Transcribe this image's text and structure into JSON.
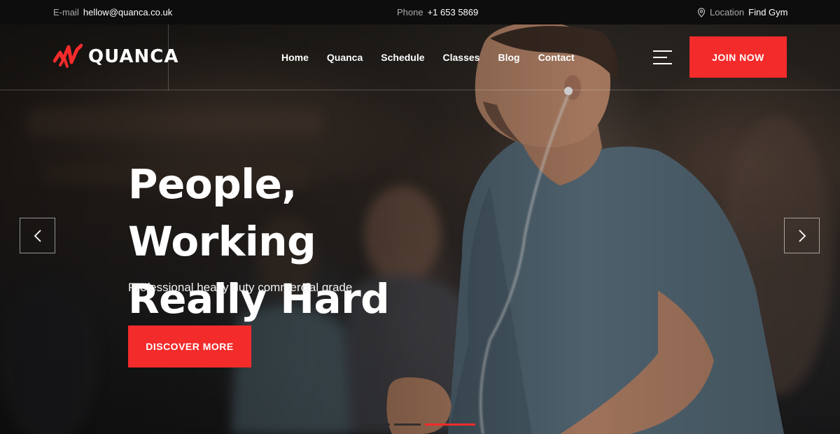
{
  "topbar": {
    "email_label": "E-mail",
    "email_value": "hellow@quanca.co.uk",
    "phone_label": "Phone",
    "phone_value": "+1 653 5869",
    "location_label": "Location",
    "location_value": "Find Gym",
    "location_icon": "map-pin-icon"
  },
  "brand": {
    "name": "QUANCA",
    "accent_color": "#f32b2b",
    "logo_icon": "quanca-logo-mark"
  },
  "nav": {
    "items": [
      {
        "label": "Home"
      },
      {
        "label": "Quanca"
      },
      {
        "label": "Schedule"
      },
      {
        "label": "Classes"
      },
      {
        "label": "Blog"
      },
      {
        "label": "Contact"
      }
    ],
    "menu_icon": "hamburger-icon",
    "cta_label": "JOIN NOW"
  },
  "hero": {
    "headline_line1": "People, Working",
    "headline_line2": "Really Hard",
    "subline": "Professional heavy duty commercial grade",
    "cta_label": "DISCOVER MORE",
    "prev_icon": "chevron-left-icon",
    "next_icon": "chevron-right-icon",
    "slides_total": 3,
    "active_slide": 3
  }
}
